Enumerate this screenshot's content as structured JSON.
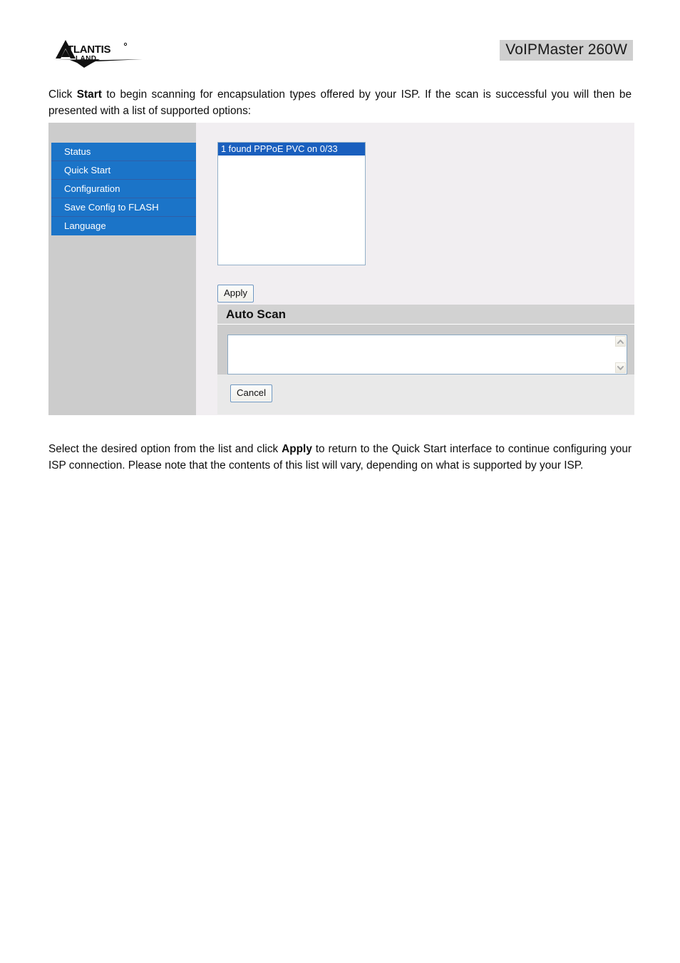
{
  "header": {
    "logo_name": "atlantis-land-logo",
    "logo_text_primary": "ATLANTIS",
    "logo_text_secondary": "LAND",
    "device_title": "VoIPMaster 260W"
  },
  "paragraphs": {
    "intro_before": "Click ",
    "intro_bold": "Start",
    "intro_after": " to begin scanning for encapsulation types offered by your ISP. If the scan is successful you will then be presented with a list of supported options:",
    "outro_before": "Select the desired option from the list and click ",
    "outro_bold": "Apply",
    "outro_after": " to return to the Quick Start interface to continue configuring your ISP connection. Please note that the contents of this list will vary, depending on what is supported by your ISP."
  },
  "router_ui": {
    "sidebar": {
      "items": [
        {
          "label": "Status"
        },
        {
          "label": "Quick Start"
        },
        {
          "label": "Configuration"
        },
        {
          "label": "Save Config to FLASH"
        },
        {
          "label": "Language"
        }
      ]
    },
    "scan_results": {
      "options": [
        {
          "label": "1 found PPPoE PVC on 0/33",
          "selected": true
        }
      ]
    },
    "apply_button": "Apply",
    "auto_scan": {
      "title": "Auto Scan",
      "log_value": "",
      "log_placeholder": "",
      "cancel_button": "Cancel"
    }
  },
  "colors": {
    "menu_blue": "#1b74c8",
    "selection_blue": "#1a5fbe",
    "sidebar_gray": "#cccccc",
    "content_bg": "#f1eef1",
    "section_header_gray": "#d2d2d2",
    "title_badge_gray": "#cfcfcf"
  }
}
